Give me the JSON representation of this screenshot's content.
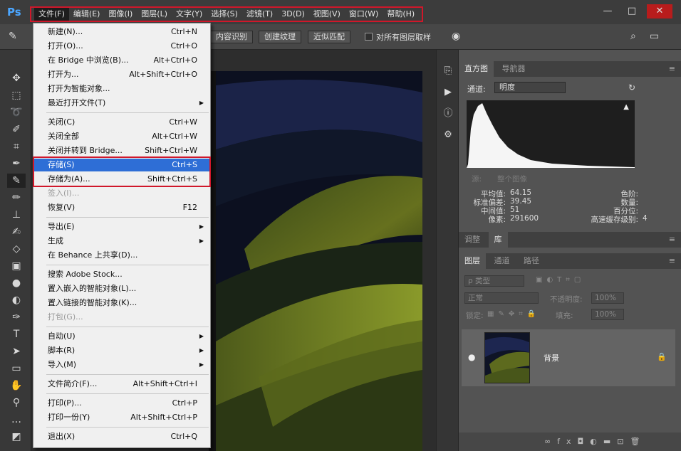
{
  "app": {
    "logo": "Ps"
  },
  "menubar": {
    "items": [
      {
        "label": "文件(F)"
      },
      {
        "label": "编辑(E)"
      },
      {
        "label": "图像(I)"
      },
      {
        "label": "图层(L)"
      },
      {
        "label": "文字(Y)"
      },
      {
        "label": "选择(S)"
      },
      {
        "label": "滤镜(T)"
      },
      {
        "label": "3D(D)"
      },
      {
        "label": "视图(V)"
      },
      {
        "label": "窗口(W)"
      },
      {
        "label": "帮助(H)"
      }
    ],
    "window_buttons": {
      "minimize": "—",
      "maximize": "□",
      "close": "✕"
    }
  },
  "options": {
    "btn1": "内容识别",
    "btn2": "创建纹理",
    "btn3": "近似匹配",
    "check_label": "对所有图层取样"
  },
  "file_menu": {
    "items": [
      {
        "label": "新建(N)...",
        "shortcut": "Ctrl+N"
      },
      {
        "label": "打开(O)...",
        "shortcut": "Ctrl+O"
      },
      {
        "label": "在 Bridge 中浏览(B)...",
        "shortcut": "Alt+Ctrl+O"
      },
      {
        "label": "打开为...",
        "shortcut": "Alt+Shift+Ctrl+O"
      },
      {
        "label": "打开为智能对象...",
        "shortcut": ""
      },
      {
        "label": "最近打开文件(T)",
        "shortcut": ""
      },
      {
        "label": "关闭(C)",
        "shortcut": "Ctrl+W"
      },
      {
        "label": "关闭全部",
        "shortcut": "Alt+Ctrl+W"
      },
      {
        "label": "关闭并转到 Bridge...",
        "shortcut": "Shift+Ctrl+W"
      },
      {
        "label": "存储(S)",
        "shortcut": "Ctrl+S"
      },
      {
        "label": "存储为(A)...",
        "shortcut": "Shift+Ctrl+S"
      },
      {
        "label": "签入(I)...",
        "shortcut": ""
      },
      {
        "label": "恢复(V)",
        "shortcut": "F12"
      },
      {
        "label": "导出(E)",
        "shortcut": ""
      },
      {
        "label": "生成",
        "shortcut": ""
      },
      {
        "label": "在 Behance 上共享(D)...",
        "shortcut": ""
      },
      {
        "label": "搜索 Adobe Stock...",
        "shortcut": ""
      },
      {
        "label": "置入嵌入的智能对象(L)...",
        "shortcut": ""
      },
      {
        "label": "置入链接的智能对象(K)...",
        "shortcut": ""
      },
      {
        "label": "打包(G)...",
        "shortcut": ""
      },
      {
        "label": "自动(U)",
        "shortcut": ""
      },
      {
        "label": "脚本(R)",
        "shortcut": ""
      },
      {
        "label": "导入(M)",
        "shortcut": ""
      },
      {
        "label": "文件简介(F)...",
        "shortcut": "Alt+Shift+Ctrl+I"
      },
      {
        "label": "打印(P)...",
        "shortcut": "Ctrl+P"
      },
      {
        "label": "打印一份(Y)",
        "shortcut": "Alt+Shift+Ctrl+P"
      },
      {
        "label": "退出(X)",
        "shortcut": "Ctrl+Q"
      }
    ]
  },
  "histogram": {
    "tabs": [
      "直方图",
      "导航器"
    ],
    "channel_label": "通道:",
    "channel_value": "明度",
    "source_label": "源:",
    "source_value": "整个图像",
    "stats": {
      "mean_label": "平均值:",
      "mean": "64.15",
      "std_label": "标准偏差:",
      "std": "39.45",
      "median_label": "中间值:",
      "median": "51",
      "pixels_label": "像素:",
      "pixels": "291600",
      "level_label": "色阶:",
      "count_label": "数量:",
      "percentile_label": "百分位:",
      "cache_label": "高速缓存级别:",
      "cache": "4"
    }
  },
  "adjust_tabs": [
    "调整",
    "库"
  ],
  "layers": {
    "tabs": [
      "图层",
      "通道",
      "路径"
    ],
    "filter_label": "ρ 类型",
    "blend_mode": "正常",
    "opacity_label": "不透明度:",
    "opacity": "100%",
    "lock_label": "锁定:",
    "fill_label": "填充:",
    "fill": "100%",
    "layer_name": "背景"
  }
}
